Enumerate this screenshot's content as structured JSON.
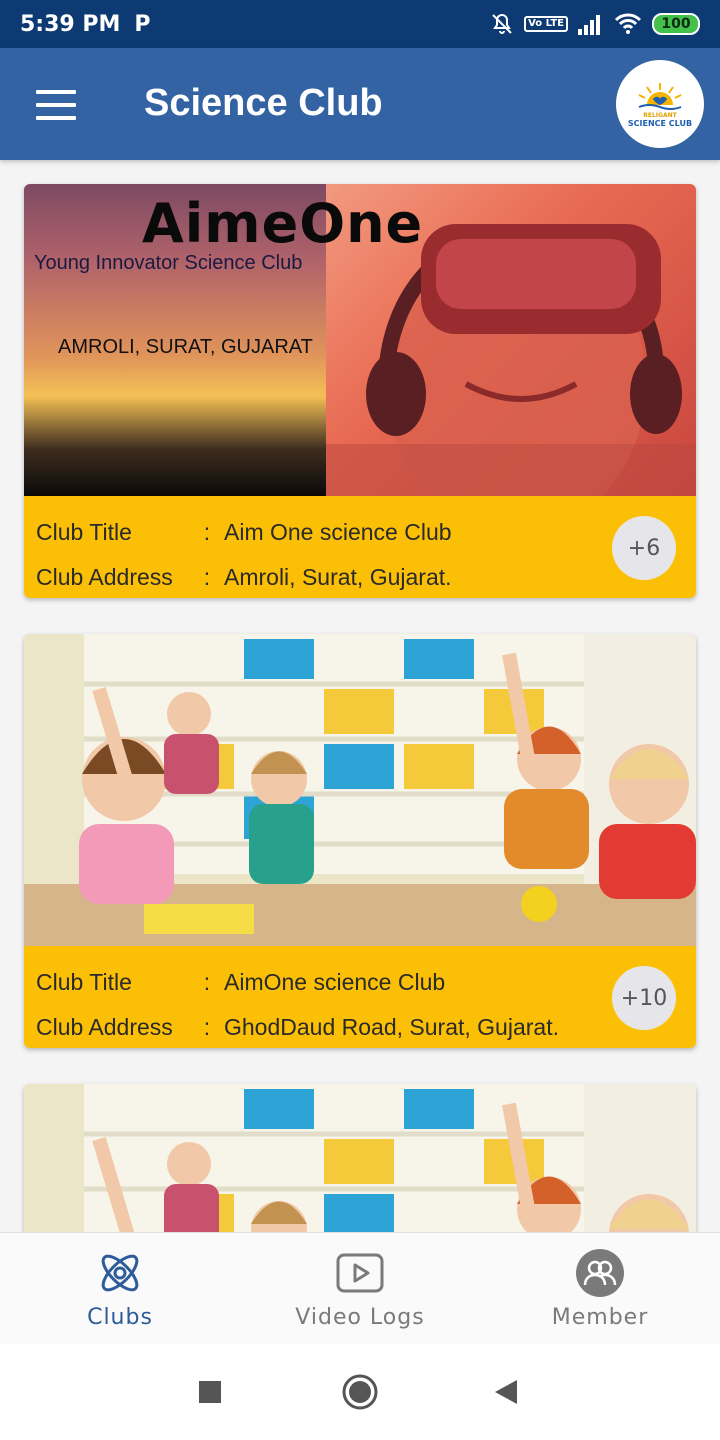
{
  "status_bar": {
    "time": "5:39 PM",
    "carrier_icon": "P",
    "lte_label": "Vo LTE",
    "battery": "100"
  },
  "app_bar": {
    "title": "Science Club",
    "logo_small": "RELIGANT",
    "logo_text": "SCIENCE CLUB"
  },
  "clubs": [
    {
      "banner_brand": "AimeOne",
      "banner_subtitle": "Young Innovator Science Club",
      "banner_location": "AMROLI, SURAT, GUJARAT",
      "title_label": "Club Title",
      "title_value": "Aim One science Club",
      "address_label": "Club Address",
      "address_value": "Amroli, Surat, Gujarat.",
      "separator": ":",
      "member_count": "+6"
    },
    {
      "title_label": "Club Title",
      "title_value": "AimOne science Club",
      "address_label": "Club Address",
      "address_value": "GhodDaud Road, Surat, Gujarat.",
      "separator": ":",
      "member_count": "+10"
    }
  ],
  "bottom_nav": {
    "items": [
      {
        "label": "Clubs",
        "icon": "atom-icon",
        "active": true
      },
      {
        "label": "Video Logs",
        "icon": "video-icon",
        "active": false
      },
      {
        "label": "Member",
        "icon": "members-icon",
        "active": false
      }
    ]
  },
  "colors": {
    "status_bar": "#0d3a73",
    "app_bar": "#3363a3",
    "card_info": "#fbbf06",
    "active_nav": "#2d5c99"
  }
}
